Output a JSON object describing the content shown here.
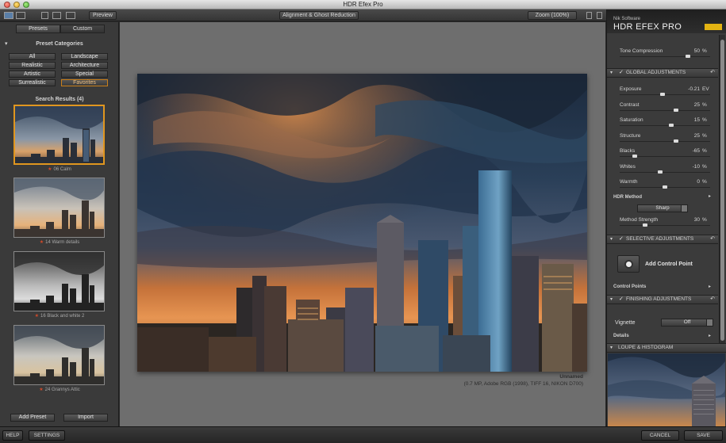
{
  "window": {
    "title": "HDR Efex Pro"
  },
  "toolbar": {
    "preview_label": "Preview",
    "alignment_label": "Alignment & Ghost Reduction",
    "zoom_label": "Zoom (100%)"
  },
  "left_panel": {
    "tabs": [
      {
        "label": "Presets",
        "active": true
      },
      {
        "label": "Custom",
        "active": false
      }
    ],
    "categories_title": "Preset Categories",
    "categories": [
      {
        "label": "All",
        "selected": false
      },
      {
        "label": "Landscape",
        "selected": false
      },
      {
        "label": "Realistic",
        "selected": false
      },
      {
        "label": "Architecture",
        "selected": false
      },
      {
        "label": "Artistic",
        "selected": false
      },
      {
        "label": "Special",
        "selected": false
      },
      {
        "label": "Surrealistic",
        "selected": false
      },
      {
        "label": "Favorites",
        "selected": true
      }
    ],
    "search_results_title": "Search Results (4)",
    "presets": [
      {
        "label": "06 Calm",
        "style": "color"
      },
      {
        "label": "14 Warm details",
        "style": "warm"
      },
      {
        "label": "16 Black and white 2",
        "style": "bw"
      },
      {
        "label": "24 Grannys Attic",
        "style": "attic"
      }
    ],
    "add_preset_label": "Add Preset",
    "import_label": "Import"
  },
  "image_info": {
    "name": "Unnamed",
    "details": "(0.7 MP, Adobe RGB (1998), TIFF 16, NIKON D700)"
  },
  "right_panel": {
    "brand_small": "Nik Software",
    "brand_big": "HDR EFEX PRO",
    "tone_compression": {
      "label": "Tone Compression",
      "value": "50",
      "unit": "%",
      "fraction": 0.75
    },
    "global_title": "GLOBAL ADJUSTMENTS",
    "global_sliders": [
      {
        "label": "Exposure",
        "value": "-0.21",
        "unit": "EV",
        "fraction": 0.47
      },
      {
        "label": "Contrast",
        "value": "25",
        "unit": "%",
        "fraction": 0.62
      },
      {
        "label": "Saturation",
        "value": "15",
        "unit": "%",
        "fraction": 0.57
      },
      {
        "label": "Structure",
        "value": "25",
        "unit": "%",
        "fraction": 0.62
      },
      {
        "label": "Blacks",
        "value": "-65",
        "unit": "%",
        "fraction": 0.17
      },
      {
        "label": "Whites",
        "value": "-10",
        "unit": "%",
        "fraction": 0.45
      },
      {
        "label": "Warmth",
        "value": "0",
        "unit": "%",
        "fraction": 0.5
      }
    ],
    "hdr_method_label": "HDR Method",
    "hdr_method_value": "Sharp",
    "method_strength": {
      "label": "Method Strength",
      "value": "30",
      "unit": "%",
      "fraction": 0.28
    },
    "selective_title": "SELECTIVE ADJUSTMENTS",
    "add_control_point_label": "Add Control Point",
    "control_points_label": "Control Points",
    "finishing_title": "FINISHING ADJUSTMENTS",
    "vignette_label": "Vignette",
    "vignette_value": "Off",
    "details_label": "Details",
    "loupe_title": "LOUPE & HISTOGRAM"
  },
  "status_bar": {
    "help_label": "HELP",
    "settings_label": "SETTINGS",
    "cancel_label": "CANCEL",
    "save_label": "SAVE"
  },
  "colors": {
    "accent_orange": "#e0961f",
    "panel_bg": "#3a3a3a",
    "canvas_bg": "#6e6e6e",
    "brand_yellow": "#e3b312"
  }
}
